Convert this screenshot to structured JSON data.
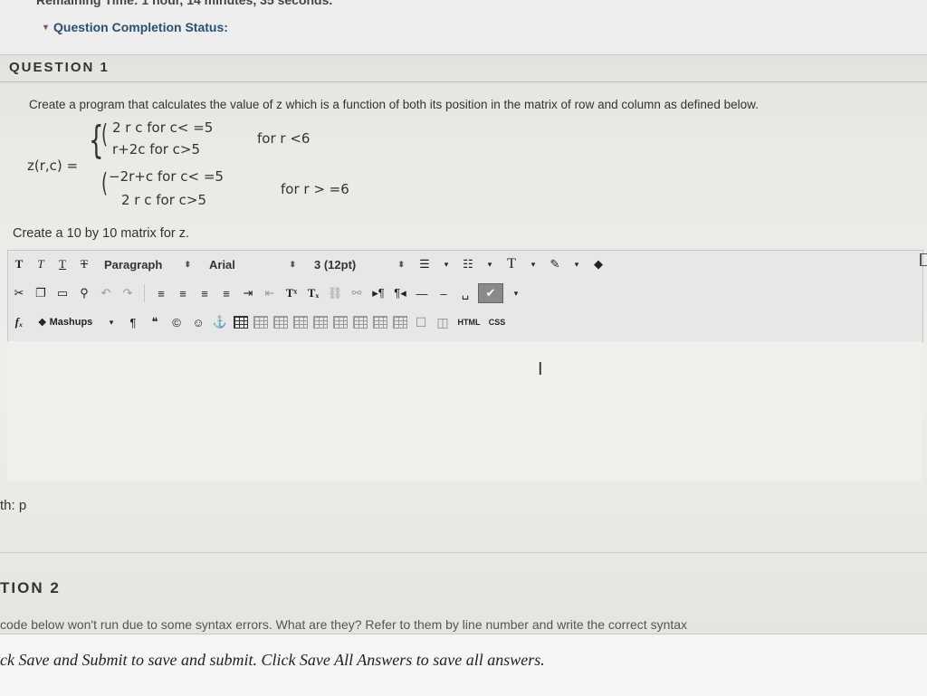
{
  "header": {
    "clipped_text": "Remaining Time: 1 hour, 14 minutes, 35 seconds.",
    "completion_label": "Question Completion Status:"
  },
  "question1": {
    "title": "QUESTION 1",
    "prompt": "Create a program that calculates the value of z which is a function of both its position in the matrix of row and column as defined below.",
    "formula": {
      "lhs": "z(r,c) =",
      "case1_a": "2 r c   for c< =5",
      "case1_b": "r+2c   for c>5",
      "case1_cond": "for r <6",
      "case2_a": "−2r+c   for c< =5",
      "case2_b": "2 r c   for c>5",
      "case2_cond": "for r > =6"
    },
    "instruction": "Create a 10 by 10 matrix for z."
  },
  "toolbar": {
    "row1": {
      "format_block": "Paragraph",
      "font_family": "Arial",
      "font_size": "3 (12pt)"
    },
    "row3": {
      "mashups_label": "Mashups",
      "html_label": "HTML",
      "css_label": "CSS"
    }
  },
  "editor": {
    "path": "th: p"
  },
  "question2": {
    "title": "TION 2",
    "text": "code below won't run due to some syntax errors. What are they? Refer to them by line number and write the correct syntax"
  },
  "footer": {
    "submit_text": "ck Save and Submit to save and submit. Click Save All Answers to save all answers."
  }
}
